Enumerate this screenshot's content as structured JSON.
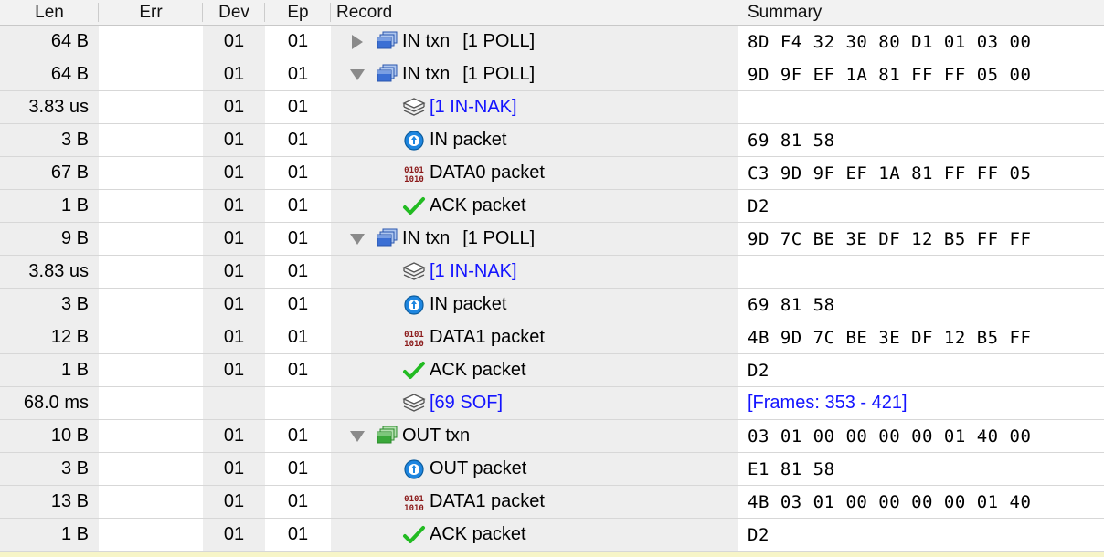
{
  "table": {
    "columns": [
      {
        "key": "len",
        "label": "Len"
      },
      {
        "key": "err",
        "label": "Err"
      },
      {
        "key": "dev",
        "label": "Dev"
      },
      {
        "key": "ep",
        "label": "Ep"
      },
      {
        "key": "rec",
        "label": "Record"
      },
      {
        "key": "sum",
        "label": "Summary"
      }
    ],
    "colors": {
      "link_blue": "#1414ff",
      "row_shaded": "#eeeeee",
      "row_plain": "#ffffff",
      "header_bg": "#f2f2f2",
      "selection_yellow": "#f7f5c8",
      "txn_in": "#3b6fd4",
      "txn_out": "#3aa83a",
      "data_icon": "#8b1a1a",
      "ack_icon": "#22bb22"
    },
    "rows": [
      {
        "len": "64 B",
        "err": "",
        "dev": "01",
        "ep": "01",
        "twisty": "collapsed",
        "indent": 0,
        "icon": "txn-in-icon",
        "label": "IN txn",
        "label_color": "black",
        "extra": "[1 POLL]",
        "summary": "8D F4 32 30 80 D1 01 03 00",
        "summary_color": "black"
      },
      {
        "len": "64 B",
        "err": "",
        "dev": "01",
        "ep": "01",
        "twisty": "expanded",
        "indent": 0,
        "icon": "txn-in-icon",
        "label": "IN txn",
        "label_color": "black",
        "extra": "[1 POLL]",
        "summary": "9D 9F EF 1A 81 FF FF 05 00",
        "summary_color": "black"
      },
      {
        "len": "3.83 us",
        "err": "",
        "dev": "01",
        "ep": "01",
        "twisty": "none",
        "indent": 1,
        "icon": "stack-icon",
        "label": "[1 IN-NAK]",
        "label_color": "blue",
        "extra": "",
        "summary": "",
        "summary_color": "black"
      },
      {
        "len": "3 B",
        "err": "",
        "dev": "01",
        "ep": "01",
        "twisty": "none",
        "indent": 1,
        "icon": "packet-token-icon",
        "label": "IN packet",
        "label_color": "black",
        "extra": "",
        "summary": "69 81 58",
        "summary_color": "black"
      },
      {
        "len": "67 B",
        "err": "",
        "dev": "01",
        "ep": "01",
        "twisty": "none",
        "indent": 1,
        "icon": "packet-data-icon",
        "label": "DATA0 packet",
        "label_color": "black",
        "extra": "",
        "summary": "C3 9D 9F EF 1A 81 FF FF 05",
        "summary_color": "black"
      },
      {
        "len": "1 B",
        "err": "",
        "dev": "01",
        "ep": "01",
        "twisty": "none",
        "indent": 1,
        "icon": "packet-ack-icon",
        "label": "ACK packet",
        "label_color": "black",
        "extra": "",
        "summary": "D2",
        "summary_color": "black"
      },
      {
        "len": "9 B",
        "err": "",
        "dev": "01",
        "ep": "01",
        "twisty": "expanded",
        "indent": 0,
        "icon": "txn-in-icon",
        "label": "IN txn",
        "label_color": "black",
        "extra": "[1 POLL]",
        "summary": "9D 7C BE 3E DF 12 B5 FF FF",
        "summary_color": "black"
      },
      {
        "len": "3.83 us",
        "err": "",
        "dev": "01",
        "ep": "01",
        "twisty": "none",
        "indent": 1,
        "icon": "stack-icon",
        "label": "[1 IN-NAK]",
        "label_color": "blue",
        "extra": "",
        "summary": "",
        "summary_color": "black"
      },
      {
        "len": "3 B",
        "err": "",
        "dev": "01",
        "ep": "01",
        "twisty": "none",
        "indent": 1,
        "icon": "packet-token-icon",
        "label": "IN packet",
        "label_color": "black",
        "extra": "",
        "summary": "69 81 58",
        "summary_color": "black"
      },
      {
        "len": "12 B",
        "err": "",
        "dev": "01",
        "ep": "01",
        "twisty": "none",
        "indent": 1,
        "icon": "packet-data-icon",
        "label": "DATA1 packet",
        "label_color": "black",
        "extra": "",
        "summary": "4B 9D 7C BE 3E DF 12 B5 FF",
        "summary_color": "black"
      },
      {
        "len": "1 B",
        "err": "",
        "dev": "01",
        "ep": "01",
        "twisty": "none",
        "indent": 1,
        "icon": "packet-ack-icon",
        "label": "ACK packet",
        "label_color": "black",
        "extra": "",
        "summary": "D2",
        "summary_color": "black"
      },
      {
        "len": "68.0 ms",
        "err": "",
        "dev": "",
        "ep": "",
        "twisty": "none",
        "indent": 1,
        "icon": "stack-icon",
        "label": "[69 SOF]",
        "label_color": "blue",
        "extra": "",
        "summary": "[Frames: 353 - 421]",
        "summary_color": "blue"
      },
      {
        "len": "10 B",
        "err": "",
        "dev": "01",
        "ep": "01",
        "twisty": "expanded",
        "indent": 0,
        "icon": "txn-out-icon",
        "label": "OUT txn",
        "label_color": "black",
        "extra": "",
        "summary": "03 01 00 00 00 00 01 40 00",
        "summary_color": "black"
      },
      {
        "len": "3 B",
        "err": "",
        "dev": "01",
        "ep": "01",
        "twisty": "none",
        "indent": 1,
        "icon": "packet-token-icon",
        "label": "OUT packet",
        "label_color": "black",
        "extra": "",
        "summary": "E1 81 58",
        "summary_color": "black"
      },
      {
        "len": "13 B",
        "err": "",
        "dev": "01",
        "ep": "01",
        "twisty": "none",
        "indent": 1,
        "icon": "packet-data-icon",
        "label": "DATA1 packet",
        "label_color": "black",
        "extra": "",
        "summary": "4B 03 01 00 00 00 00 01 40",
        "summary_color": "black"
      },
      {
        "len": "1 B",
        "err": "",
        "dev": "01",
        "ep": "01",
        "twisty": "none",
        "indent": 1,
        "icon": "packet-ack-icon",
        "label": "ACK packet",
        "label_color": "black",
        "extra": "",
        "summary": "D2",
        "summary_color": "black"
      }
    ]
  }
}
